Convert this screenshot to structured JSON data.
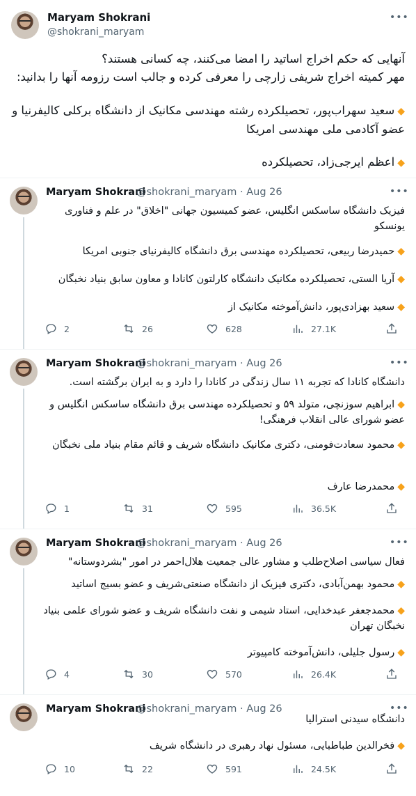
{
  "main": {
    "name": "Maryam Shokrani",
    "handle": "@shokrani_maryam",
    "line1": "آنهایی که حکم اخراج اساتید را امضا می‌کنند، چه کسانی هستند؟",
    "line2": "مهر کمیته اخراج شریفی زارچی را معرفی کرده و جالب است رزومه آنها را بدانید:",
    "item1": "سعید سهراب‌پور، تحصیلکرده رشته مهندسی مکانیک از دانشگاه برکلی کالیفرنیا و عضو آکادمی ملی مهندسی امریکا",
    "item2": "اعظم ایرجی‌زاد، تحصیلکرده"
  },
  "replies": [
    {
      "name": "Maryam Shokrani",
      "meta": "@shokrani_maryam · Aug 26",
      "intro": "فیزیک دانشگاه ساسکس انگلیس، عضو کمیسیون جهانی \"اخلاق\" در علم و فناوری یونسکو",
      "items": [
        "حمیدرضا ربیعی، تحصیلکرده مهندسی برق دانشگاه کالیفرنیای جنوبی امریکا",
        "آریا الستی، تحصیلکرده مکانیک دانشگاه کارلتون کانادا و معاون سابق بنیاد نخبگان",
        "سعید بهزادی‌پور، دانش‌آموخته مکانیک از"
      ],
      "replies": "2",
      "retweets": "26",
      "likes": "628",
      "views": "27.1K"
    },
    {
      "name": "Maryam Shokrani",
      "meta": "@shokrani_maryam · Aug 26",
      "intro": "دانشگاه کانادا که تجربه ۱۱ سال زندگی در کانادا را دارد و به ایران برگشته است.",
      "items": [
        "ابراهیم سوزنچی، متولد ۵۹ و تحصیلکرده مهندسی برق دانشگاه ساسکس انگلیس و عضو شورای عالی انقلاب فرهنگی!",
        "محمود سعادت‌فومنی، دکتری مکانیک دانشگاه شریف و قائم مقام بنیاد ملی نخبگان",
        "محمدرضا عارف"
      ],
      "replies": "1",
      "retweets": "31",
      "likes": "595",
      "views": "36.5K"
    },
    {
      "name": "Maryam Shokrani",
      "meta": "@shokrani_maryam · Aug 26",
      "intro": "فعال سیاسی اصلاح‌طلب و مشاور عالی جمعیت هلال‌احمر در امور \"بشردوستانه\"",
      "items": [
        "محمود بهمن‌آبادی، دکتری فیزیک از دانشگاه صنعتی‌شریف و عضو بسیج اساتید",
        "محمدجعفر عبدخدایی، استاد شیمی و نفت دانشگاه شریف و عضو شورای علمی بنیاد نخبگان تهران",
        "رسول جلیلی، دانش‌آموخته کامپیوتر"
      ],
      "replies": "4",
      "retweets": "30",
      "likes": "570",
      "views": "26.4K"
    },
    {
      "name": "Maryam Shokrani",
      "meta": "@shokrani_maryam · Aug 26",
      "intro": "دانشگاه سیدنی استرالیا",
      "items": [
        "فخرالدین طباطبایی، مسئول نهاد رهبری در دانشگاه شریف"
      ],
      "replies": "10",
      "retweets": "22",
      "likes": "591",
      "views": "24.5K"
    }
  ],
  "icons": {
    "more": "more-dots-icon",
    "reply": "reply-bubble-icon",
    "retweet": "retweet-icon",
    "like": "heart-icon",
    "views": "views-chart-icon",
    "share": "share-icon",
    "bullet": "orange-diamond-icon"
  },
  "colors": {
    "bullet": "#f7a21b",
    "muted": "#536471",
    "thread_line": "#cfd9de"
  }
}
